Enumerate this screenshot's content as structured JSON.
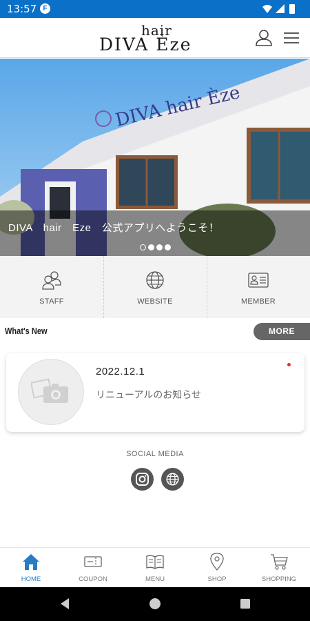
{
  "status_bar": {
    "time": "13:57",
    "notification_icon": "app-notification-icon",
    "system_icons": [
      "wifi-icon",
      "signal-icon",
      "battery-icon"
    ]
  },
  "header": {
    "logo_top": "hair",
    "logo_main": "DIVA Èze",
    "account_icon": "user-icon",
    "menu_icon": "hamburger-menu-icon"
  },
  "hero": {
    "sign_text": "DIVA hair Èze",
    "caption": "DIVA　hair　Eze　公式アプリへようこそ！",
    "slide_count": 4,
    "active_slide": 1
  },
  "quick_nav": [
    {
      "label": "STAFF",
      "icon": "staff-icon"
    },
    {
      "label": "WEBSITE",
      "icon": "globe-icon"
    },
    {
      "label": "MEMBER",
      "icon": "member-card-icon"
    }
  ],
  "whats_new": {
    "title": "What's New",
    "more_label": "MORE",
    "items": [
      {
        "date": "2022.12.1",
        "text": "リニューアルのお知らせ",
        "unread": true
      }
    ]
  },
  "social": {
    "title": "SOCIAL MEDIA",
    "links": [
      "instagram-icon",
      "globe-icon"
    ]
  },
  "tabs": [
    {
      "label": "HOME",
      "icon": "home-icon",
      "active": true
    },
    {
      "label": "COUPON",
      "icon": "coupon-icon",
      "active": false
    },
    {
      "label": "MENU",
      "icon": "book-icon",
      "active": false
    },
    {
      "label": "SHOP",
      "icon": "map-pin-icon",
      "active": false
    },
    {
      "label": "SHOPPING",
      "icon": "cart-icon",
      "active": false
    }
  ],
  "colors": {
    "status_bar": "#0a70c8",
    "active_tab": "#2a7bc4",
    "more_button": "#666666",
    "unread_dot": "#e03030"
  }
}
